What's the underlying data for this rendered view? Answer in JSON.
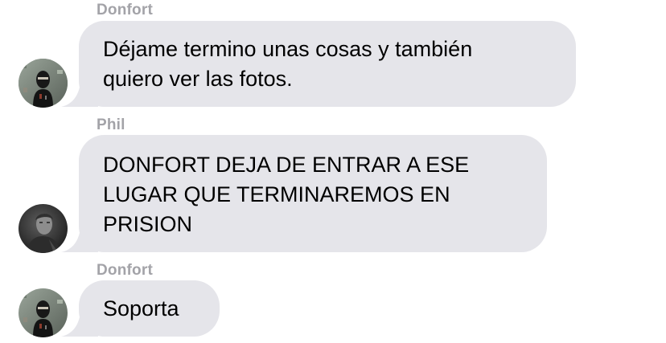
{
  "messages": [
    {
      "sender": "Donfort",
      "avatar": "masked-figure-avatar",
      "lines": [
        "Déjame termino unas cosas y también",
        "quiero ver las fotos."
      ]
    },
    {
      "sender": "Phil",
      "avatar": "bw-portrait-avatar",
      "lines": [
        "DONFORT DEJA DE ENTRAR A ESE",
        "LUGAR QUE TERMINAREMOS EN",
        "PRISION"
      ]
    },
    {
      "sender": "Donfort",
      "avatar": "masked-figure-avatar",
      "lines": [
        "Soporta"
      ]
    }
  ],
  "colors": {
    "bubble": "#e5e5ea",
    "sender_label": "#a3a3a8",
    "text": "#000000",
    "background": "#ffffff"
  }
}
